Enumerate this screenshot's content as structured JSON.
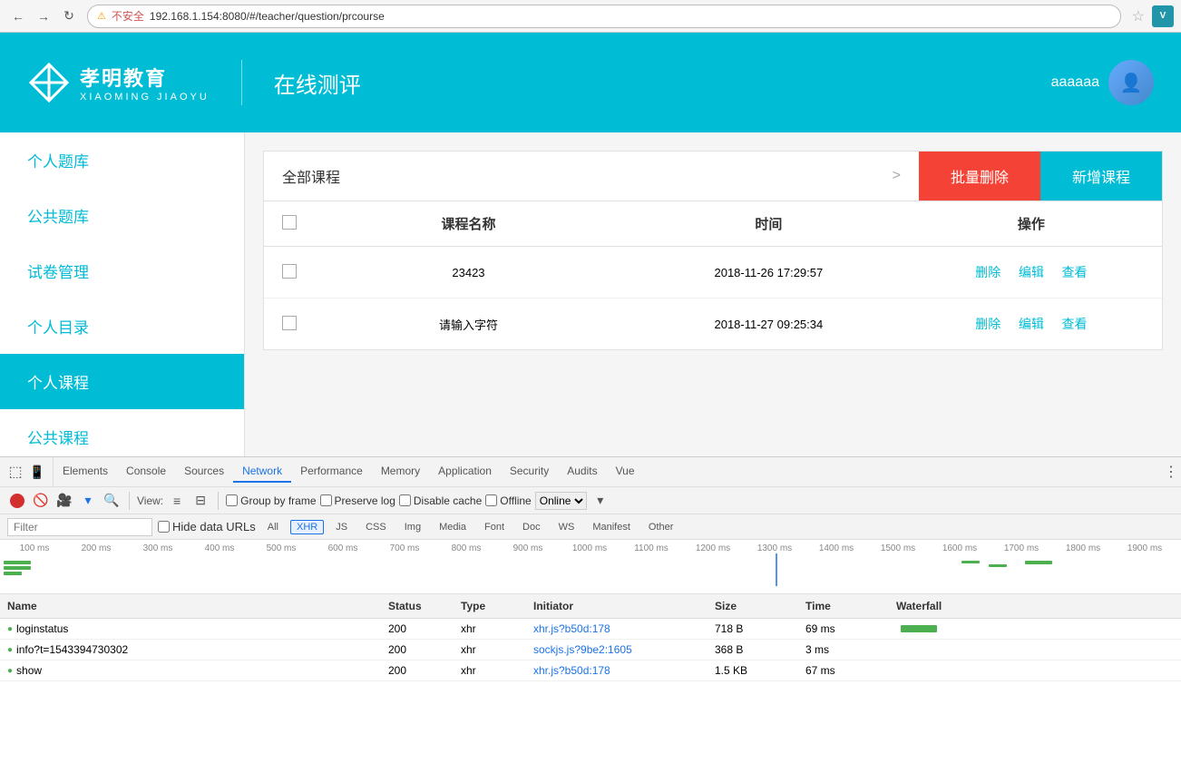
{
  "browser": {
    "back_label": "←",
    "forward_label": "→",
    "refresh_label": "↻",
    "address": "192.168.1.154:8080/#/teacher/question/prcourse",
    "security_label": "不安全",
    "star_label": "☆",
    "ext_label": "V"
  },
  "header": {
    "logo_title": "孝明教育",
    "logo_subtitle": "XIAOMING JIAOYU",
    "app_name": "在线测评",
    "user_name": "aaaaaa",
    "divider": "|"
  },
  "sidebar": {
    "items": [
      {
        "label": "个人题库",
        "active": false
      },
      {
        "label": "公共题库",
        "active": false
      },
      {
        "label": "试卷管理",
        "active": false
      },
      {
        "label": "个人目录",
        "active": false
      },
      {
        "label": "个人课程",
        "active": true
      },
      {
        "label": "公共课程",
        "active": false
      }
    ]
  },
  "course": {
    "title": "全部课程",
    "arrow": ">",
    "btn_delete": "批量删除",
    "btn_add": "新增课程",
    "table_header": {
      "name": "课程名称",
      "time": "时间",
      "action": "操作"
    },
    "rows": [
      {
        "name": "23423",
        "time": "2018-11-26 17:29:57",
        "delete": "删除",
        "edit": "编辑",
        "view": "查看"
      },
      {
        "name": "请输入字符",
        "time": "2018-11-27 09:25:34",
        "delete": "删除",
        "edit": "编辑",
        "view": "查看"
      }
    ]
  },
  "devtools": {
    "tabs": [
      "Elements",
      "Console",
      "Sources",
      "Network",
      "Performance",
      "Memory",
      "Application",
      "Security",
      "Audits",
      "Vue"
    ],
    "active_tab": "Network",
    "options": {
      "group_by_frame": "Group by frame",
      "preserve_log": "Preserve log",
      "disable_cache": "Disable cache",
      "offline": "Offline",
      "online_label": "Online"
    },
    "filter": {
      "placeholder": "Filter",
      "hide_data_urls": "Hide data URLs",
      "tags": [
        "All",
        "XHR",
        "JS",
        "CSS",
        "Img",
        "Media",
        "Font",
        "Doc",
        "WS",
        "Manifest",
        "Other"
      ]
    },
    "active_filter": "XHR",
    "timeline_labels": [
      "100 ms",
      "200 ms",
      "300 ms",
      "400 ms",
      "500 ms",
      "600 ms",
      "700 ms",
      "800 ms",
      "900 ms",
      "1000 ms",
      "1100 ms",
      "1200 ms",
      "1300 ms",
      "1400 ms",
      "1500 ms",
      "1600 ms",
      "1700 ms",
      "1800 ms",
      "1900 ms"
    ],
    "network_headers": [
      "Name",
      "Status",
      "Type",
      "Initiator",
      "Size",
      "Time",
      "Waterfall"
    ],
    "network_rows": [
      {
        "name": "loginstatus",
        "status": "200",
        "type": "xhr",
        "initiator": "xhr.js?b50d:178",
        "size": "718 B",
        "time": "69 ms",
        "waterfall": true
      },
      {
        "name": "info?t=1543394730302",
        "status": "200",
        "type": "xhr",
        "initiator": "sockjs.js?9be2:1605",
        "size": "368 B",
        "time": "3 ms",
        "waterfall": false
      },
      {
        "name": "show",
        "status": "200",
        "type": "xhr",
        "initiator": "xhr.js?b50d:178",
        "size": "1.5 KB",
        "time": "67 ms",
        "waterfall": false
      }
    ]
  }
}
